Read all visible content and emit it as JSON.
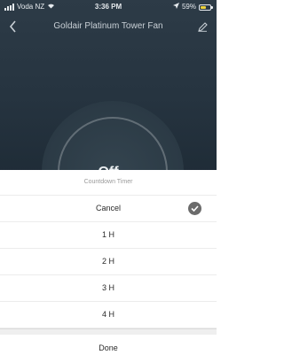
{
  "status_bar": {
    "carrier": "Voda NZ",
    "time": "3:36 PM",
    "battery_text": "59%",
    "battery_level": 0.59,
    "battery_color": "#f0d43a"
  },
  "nav": {
    "back_icon": "chevron-left-icon",
    "title": "Goldair Platinum Tower Fan",
    "edit_icon": "pencil-icon"
  },
  "device": {
    "power_state": "Off"
  },
  "sheet": {
    "title": "Countdown Timer",
    "options": [
      {
        "label": "Cancel",
        "selected": true
      },
      {
        "label": "1 H",
        "selected": false
      },
      {
        "label": "2 H",
        "selected": false
      },
      {
        "label": "3 H",
        "selected": false
      },
      {
        "label": "4 H",
        "selected": false
      }
    ],
    "done_label": "Done"
  }
}
